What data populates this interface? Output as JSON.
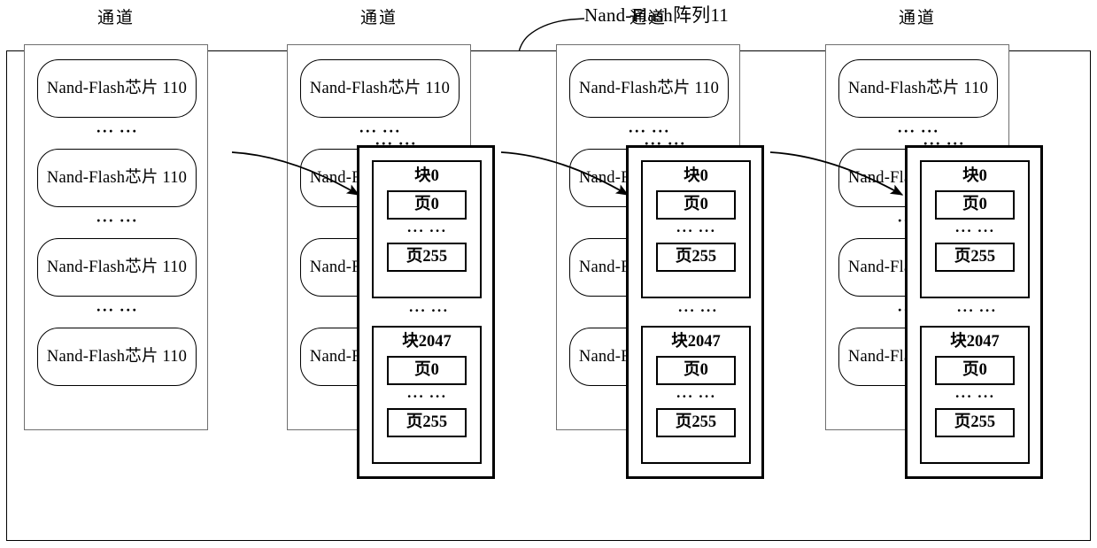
{
  "figure": {
    "title": "Nand-Flash阵列11",
    "ellipsis": "··· ···"
  },
  "channels": [
    {
      "label": "通道",
      "chips": [
        "Nand-Flash芯片 110",
        "Nand-Flash芯片 110",
        "Nand-Flash芯片 110",
        "Nand-Flash芯片 110"
      ],
      "has_detail": false
    },
    {
      "label": "通道",
      "chips": [
        "Nand-Flash芯片 110",
        "Nand-Flash芯片 110",
        "Nand-Flash芯片 110",
        "Nand-Flash芯片 110"
      ],
      "has_detail": true,
      "detail": {
        "blocks": [
          {
            "label": "块0",
            "pages": [
              "页0",
              "页255"
            ],
            "page_ellipsis": "··· ···"
          },
          {
            "label": "块2047",
            "pages": [
              "页0",
              "页255"
            ],
            "page_ellipsis": "··· ···"
          }
        ],
        "block_ellipsis": "··· ···",
        "top_ellipsis": "··· ···"
      }
    },
    {
      "label": "通道",
      "chips": [
        "Nand-Flash芯片 110",
        "Nand-Flash芯片 110",
        "Nand-Flash芯片 110",
        "Nand-Flash芯片 110"
      ],
      "has_detail": true,
      "detail": {
        "blocks": [
          {
            "label": "块0",
            "pages": [
              "页0",
              "页255"
            ],
            "page_ellipsis": "··· ···"
          },
          {
            "label": "块2047",
            "pages": [
              "页0",
              "页255"
            ],
            "page_ellipsis": "··· ···"
          }
        ],
        "block_ellipsis": "··· ···",
        "top_ellipsis": "··· ···"
      }
    },
    {
      "label": "通道",
      "chips": [
        "Nand-Flash芯片 110",
        "Nand-Flash芯片 110",
        "Nand-Flash芯片 110",
        "Nand-Flash芯片 110"
      ],
      "has_detail": true,
      "detail": {
        "blocks": [
          {
            "label": "块0",
            "pages": [
              "页0",
              "页255"
            ],
            "page_ellipsis": "··· ···"
          },
          {
            "label": "块2047",
            "pages": [
              "页0",
              "页255"
            ],
            "page_ellipsis": "··· ···"
          }
        ],
        "block_ellipsis": "··· ···",
        "top_ellipsis": "··· ···"
      }
    }
  ],
  "colors": {
    "stroke": "#000000",
    "channel_stroke": "#6f6f6f",
    "background": "#ffffff"
  }
}
